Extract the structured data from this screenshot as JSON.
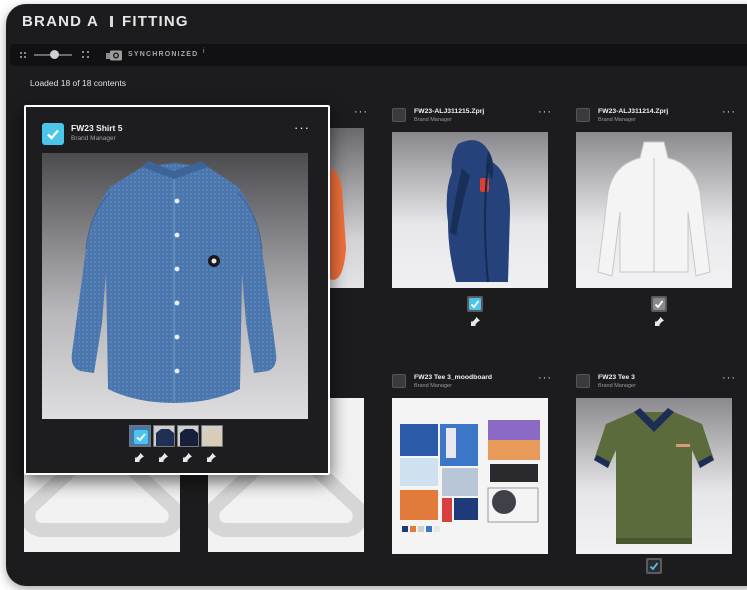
{
  "header": {
    "brand": "BRAND A",
    "section": "FITTING"
  },
  "toolbar": {
    "zoom_level": 0.55,
    "sync_label": "SYNCHRONIZED",
    "info_glyph": "i"
  },
  "status": {
    "loaded_text": "Loaded 18 of 18 contents"
  },
  "icons": {
    "more": "···",
    "check": "check-icon",
    "pin": "pin-icon",
    "camera": "camera-icon",
    "grid": "grid-icon"
  },
  "colors": {
    "accent": "#4bc6ea",
    "background": "#1c1c1e",
    "toolbar": "#111113"
  },
  "featured": {
    "name": "FW23 Shirt 5",
    "role": "Brand Manager",
    "selected": true,
    "swatches": [
      "denim-blue",
      "navy",
      "dark-navy",
      "beige"
    ]
  },
  "cards": [
    {
      "name": "FW23-ALJ311215.Zprj",
      "role": "Brand Manager"
    },
    {
      "name": "FW23-ALJ311214.Zprj",
      "role": "Brand Manager"
    },
    {
      "name": "FW23 Tee 3_moodboard",
      "role": "Brand Manager"
    },
    {
      "name": "FW23 Tee 3",
      "role": "Brand Manager"
    }
  ]
}
